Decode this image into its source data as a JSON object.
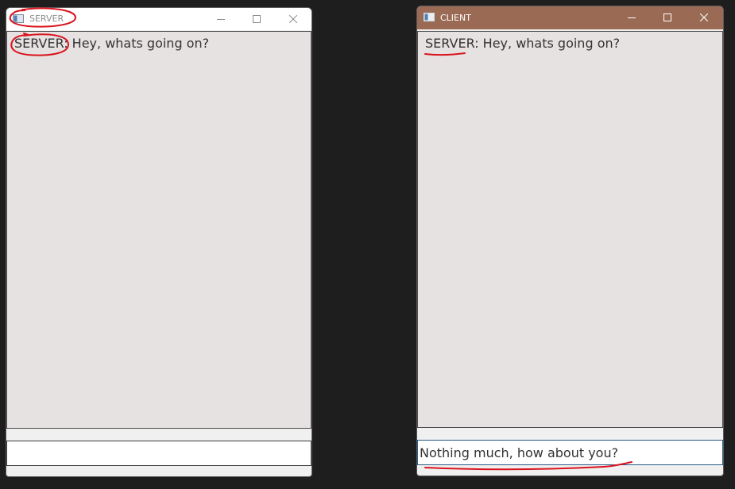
{
  "server": {
    "title": "SERVER",
    "messages": [
      {
        "sender": "SERVER:",
        "text": "Hey, whats going on?"
      }
    ],
    "input_value": ""
  },
  "client": {
    "title": "CLIENT",
    "messages": [
      {
        "sender": "SERVER:",
        "text": "Hey, whats going on?"
      }
    ],
    "input_value": "Nothing much, how about you?"
  },
  "icons": [
    "app-window-icon",
    "minimize-icon",
    "maximize-icon",
    "close-icon"
  ],
  "colors": {
    "desktop_background": "#1e1e1e",
    "client_titlebar": "#9b6a54",
    "server_titlebar": "#ffffff",
    "chat_background": "#e6e2e1",
    "annotation_red": "#d9141e"
  }
}
